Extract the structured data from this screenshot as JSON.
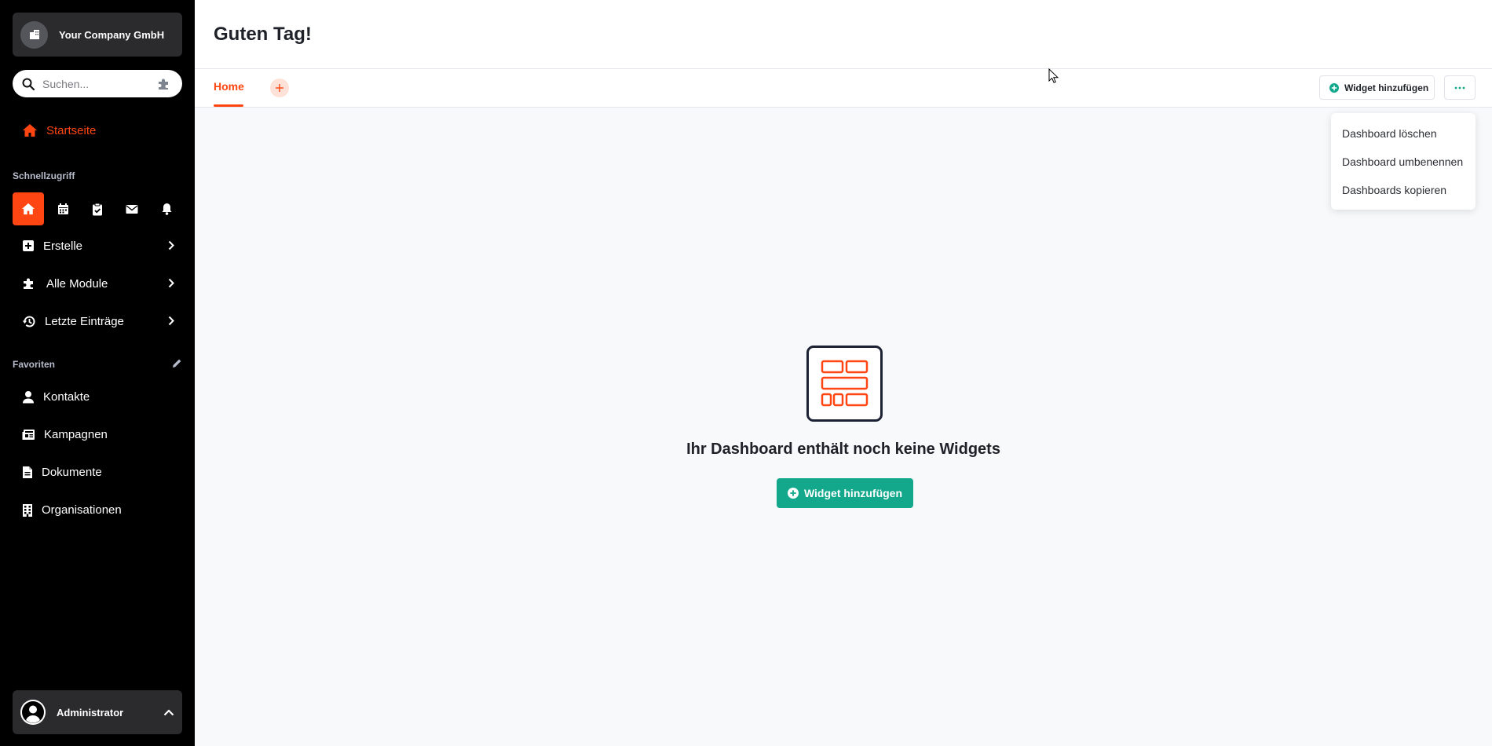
{
  "sidebar": {
    "company": "Your Company GmbH",
    "search_placeholder": "Suchen...",
    "home": "Startseite",
    "quick_access_title": "Schnellzugriff",
    "quick_icons": [
      "home-icon",
      "calendar-icon",
      "clipboard-check-icon",
      "mail-icon",
      "bell-icon"
    ],
    "menu": [
      {
        "label": "Erstelle",
        "icon": "plus-square-icon"
      },
      {
        "label": "Alle Module",
        "icon": "puzzle-icon"
      },
      {
        "label": "Letzte Einträge",
        "icon": "history-icon"
      }
    ],
    "favorites_title": "Favoriten",
    "favorites": [
      {
        "label": "Kontakte",
        "icon": "person-icon"
      },
      {
        "label": "Kampagnen",
        "icon": "newspaper-icon"
      },
      {
        "label": "Dokumente",
        "icon": "document-icon"
      },
      {
        "label": "Organisationen",
        "icon": "building-icon"
      }
    ],
    "user": "Administrator"
  },
  "header": {
    "title": "Guten Tag!"
  },
  "tabs": {
    "items": [
      {
        "label": "Home",
        "active": true
      }
    ]
  },
  "toolbar": {
    "add_widget": "Widget hinzufügen",
    "more": "···"
  },
  "dropdown": {
    "items": [
      "Dashboard löschen",
      "Dashboard umbenennen",
      "Dashboards kopieren"
    ]
  },
  "empty_state": {
    "title": "Ihr Dashboard enthält noch keine Widgets",
    "button": "Widget hinzufügen"
  },
  "colors": {
    "accent": "#ff4612",
    "primary_button": "#13a88c",
    "sidebar_bg": "#000000"
  }
}
